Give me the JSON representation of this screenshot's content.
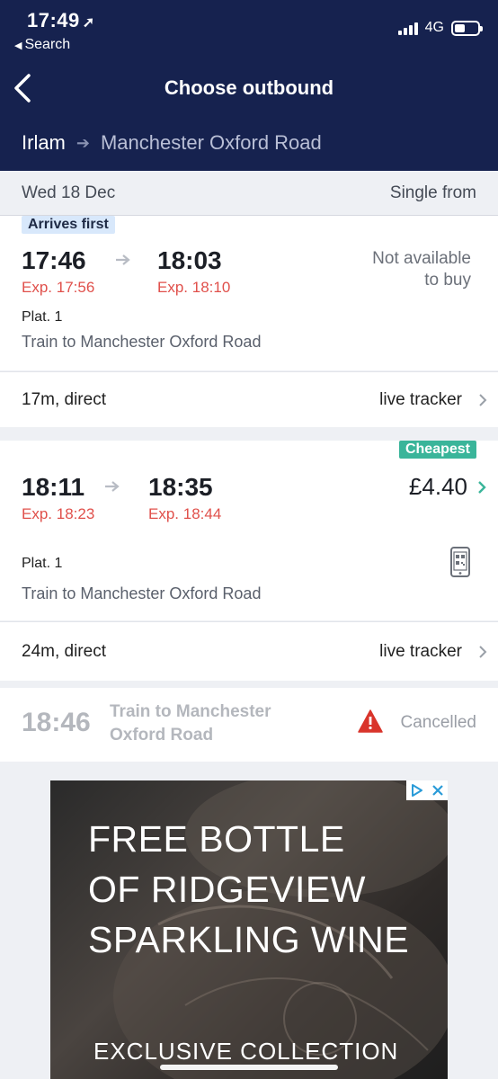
{
  "status_bar": {
    "time": "17:49",
    "back_app": "Search",
    "network": "4G",
    "battery_level": 0.45
  },
  "header": {
    "title": "Choose outbound",
    "from": "Irlam",
    "to": "Manchester Oxford Road"
  },
  "datebar": {
    "date": "Wed 18 Dec",
    "fare_type": "Single from"
  },
  "journeys": [
    {
      "badge": "Arrives first",
      "depart": "17:46",
      "depart_exp": "Exp. 17:56",
      "arrive": "18:03",
      "arrive_exp": "Exp. 18:10",
      "availability": [
        "Not available",
        "to buy"
      ],
      "platform": "Plat. 1",
      "destination": "Train to Manchester Oxford Road",
      "duration": "17m, direct",
      "link": "live tracker"
    },
    {
      "badge": "Cheapest",
      "depart": "18:11",
      "depart_exp": "Exp. 18:23",
      "arrive": "18:35",
      "arrive_exp": "Exp. 18:44",
      "price": "£4.40",
      "platform": "Plat. 1",
      "destination": "Train to Manchester Oxford Road",
      "duration": "24m, direct",
      "link": "live tracker"
    },
    {
      "depart": "18:46",
      "destination_lines": [
        "Train to Manchester",
        "Oxford Road"
      ],
      "status": "Cancelled"
    }
  ],
  "ad": {
    "lines": [
      "FREE BOTTLE",
      "OF RIDGEVIEW",
      "SPARKLING WINE"
    ],
    "footer": "EXCLUSIVE COLLECTION"
  },
  "colors": {
    "header_bg": "#16224f",
    "expected_red": "#e0504b",
    "cheapest_green": "#3ab59a",
    "arrives_first_blue": "#d8e8fb",
    "warning_red": "#d9342b"
  }
}
